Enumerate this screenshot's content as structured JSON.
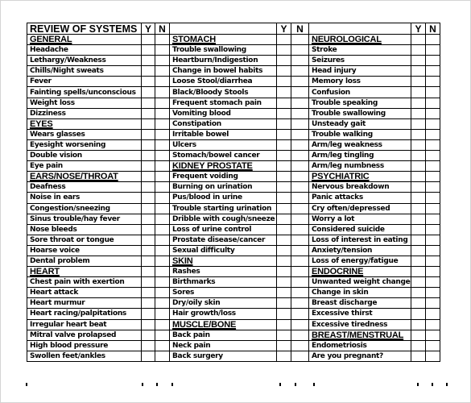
{
  "form": {
    "title": "REVIEW OF SYSTEMS",
    "yes_label": "Y",
    "no_label": "N"
  },
  "rows": [
    [
      {
        "text": "GENERAL",
        "type": "section"
      },
      {
        "text": "STOMACH",
        "type": "section"
      },
      {
        "text": "NEUROLOGICAL",
        "type": "section"
      }
    ],
    [
      {
        "text": "Headache",
        "type": "item"
      },
      {
        "text": "Trouble swallowing",
        "type": "item"
      },
      {
        "text": "Stroke",
        "type": "item"
      }
    ],
    [
      {
        "text": "Lethargy/Weakness",
        "type": "item"
      },
      {
        "text": "Heartburn/Indigestion",
        "type": "item"
      },
      {
        "text": "Seizures",
        "type": "item"
      }
    ],
    [
      {
        "text": "Chills/Night sweats",
        "type": "item"
      },
      {
        "text": "Change in bowel habits",
        "type": "item"
      },
      {
        "text": "Head injury",
        "type": "item"
      }
    ],
    [
      {
        "text": "Fever",
        "type": "item"
      },
      {
        "text": "Loose Stool/diarrhea",
        "type": "item"
      },
      {
        "text": "Memory loss",
        "type": "item"
      }
    ],
    [
      {
        "text": "Fainting spells/unconscious",
        "type": "item"
      },
      {
        "text": "Black/Bloody Stools",
        "type": "item"
      },
      {
        "text": "Confusion",
        "type": "item"
      }
    ],
    [
      {
        "text": "Weight loss",
        "type": "item"
      },
      {
        "text": "Frequent stomach pain",
        "type": "item"
      },
      {
        "text": "Trouble speaking",
        "type": "item"
      }
    ],
    [
      {
        "text": "Dizziness",
        "type": "item"
      },
      {
        "text": "Vomiting blood",
        "type": "item"
      },
      {
        "text": "Trouble swallowing",
        "type": "item"
      }
    ],
    [
      {
        "text": "EYES",
        "type": "section"
      },
      {
        "text": "Constipation",
        "type": "item"
      },
      {
        "text": "Unsteady gait",
        "type": "item"
      }
    ],
    [
      {
        "text": "Wears glasses",
        "type": "item"
      },
      {
        "text": "Irritable bowel",
        "type": "item"
      },
      {
        "text": "Trouble walking",
        "type": "item"
      }
    ],
    [
      {
        "text": "Eyesight worsening",
        "type": "item"
      },
      {
        "text": "Ulcers",
        "type": "item"
      },
      {
        "text": "Arm/leg weakness",
        "type": "item"
      }
    ],
    [
      {
        "text": "Double vision",
        "type": "item"
      },
      {
        "text": "Stomach/bowel cancer",
        "type": "item"
      },
      {
        "text": "Arm/leg tingling",
        "type": "item"
      }
    ],
    [
      {
        "text": "Eye pain",
        "type": "item"
      },
      {
        "text": "KIDNEY PROSTATE",
        "type": "section"
      },
      {
        "text": "Arm/leg numbness",
        "type": "item"
      }
    ],
    [
      {
        "text": "EARS/NOSE/THROAT",
        "type": "section"
      },
      {
        "text": "Frequent voiding",
        "type": "item"
      },
      {
        "text": "PSYCHIATRIC",
        "type": "section"
      }
    ],
    [
      {
        "text": "Deafness",
        "type": "item"
      },
      {
        "text": "Burning on urination",
        "type": "item"
      },
      {
        "text": "Nervous breakdown",
        "type": "item"
      }
    ],
    [
      {
        "text": "Noise in ears",
        "type": "item"
      },
      {
        "text": "Pus/blood in urine",
        "type": "item"
      },
      {
        "text": "Panic attacks",
        "type": "item"
      }
    ],
    [
      {
        "text": "Congestion/sneezing",
        "type": "item"
      },
      {
        "text": "Trouble starting urination",
        "type": "item"
      },
      {
        "text": "Cry often/depressed",
        "type": "item"
      }
    ],
    [
      {
        "text": "Sinus trouble/hay fever",
        "type": "item"
      },
      {
        "text": "Dribble with cough/sneeze",
        "type": "item"
      },
      {
        "text": "Worry a lot",
        "type": "item"
      }
    ],
    [
      {
        "text": "Nose bleeds",
        "type": "item"
      },
      {
        "text": "Loss of urine control",
        "type": "item"
      },
      {
        "text": "Considered suicide",
        "type": "item"
      }
    ],
    [
      {
        "text": "Sore throat or tongue",
        "type": "item"
      },
      {
        "text": "Prostate disease/cancer",
        "type": "item"
      },
      {
        "text": "Loss of interest in eating",
        "type": "item"
      }
    ],
    [
      {
        "text": "Hoarse voice",
        "type": "item"
      },
      {
        "text": "Sexual difficulty",
        "type": "item"
      },
      {
        "text": "Anxiety/tension",
        "type": "item"
      }
    ],
    [
      {
        "text": "Dental problem",
        "type": "item"
      },
      {
        "text": "SKIN",
        "type": "section"
      },
      {
        "text": "Loss of energy/fatigue",
        "type": "item"
      }
    ],
    [
      {
        "text": "HEART",
        "type": "section"
      },
      {
        "text": "Rashes",
        "type": "item"
      },
      {
        "text": "ENDOCRINE",
        "type": "section"
      }
    ],
    [
      {
        "text": "Chest pain with exertion",
        "type": "item"
      },
      {
        "text": "Birthmarks",
        "type": "item"
      },
      {
        "text": "Unwanted weight change",
        "type": "item"
      }
    ],
    [
      {
        "text": "Heart attack",
        "type": "item"
      },
      {
        "text": "Sores",
        "type": "item"
      },
      {
        "text": "Change in skin",
        "type": "item"
      }
    ],
    [
      {
        "text": "Heart murmur",
        "type": "item"
      },
      {
        "text": "Dry/oily skin",
        "type": "item"
      },
      {
        "text": "Breast discharge",
        "type": "item"
      }
    ],
    [
      {
        "text": "Heart racing/palpitations",
        "type": "item"
      },
      {
        "text": "Hair growth/loss",
        "type": "item"
      },
      {
        "text": "Excessive thirst",
        "type": "item"
      }
    ],
    [
      {
        "text": "Irregular heart beat",
        "type": "item"
      },
      {
        "text": "MUSCLE/BONE",
        "type": "section"
      },
      {
        "text": "Excessive tiredness",
        "type": "item"
      }
    ],
    [
      {
        "text": "Mitral valve prolapsed",
        "type": "item"
      },
      {
        "text": "Back pain",
        "type": "item"
      },
      {
        "text": "BREAST/MENSTRUAL",
        "type": "section"
      }
    ],
    [
      {
        "text": "High blood pressure",
        "type": "item"
      },
      {
        "text": "Neck pain",
        "type": "item"
      },
      {
        "text": "Endometriosis",
        "type": "item"
      }
    ],
    [
      {
        "text": "Swollen feet/ankles",
        "type": "item"
      },
      {
        "text": "Back surgery",
        "type": "item"
      },
      {
        "text": "Are you pregnant?",
        "type": "item"
      }
    ]
  ]
}
